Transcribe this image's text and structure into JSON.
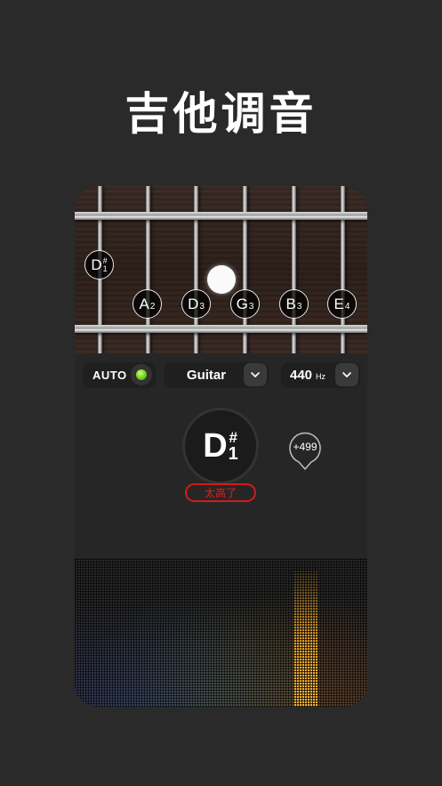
{
  "headline": "吉他调音",
  "strings": [
    {
      "letter": "A",
      "octave": "2"
    },
    {
      "letter": "D",
      "octave": "3"
    },
    {
      "letter": "G",
      "octave": "3"
    },
    {
      "letter": "B",
      "octave": "3"
    },
    {
      "letter": "E",
      "octave": "4"
    }
  ],
  "detected_marker": {
    "letter": "D",
    "sharp": "#",
    "octave": "1"
  },
  "controls": {
    "auto_label": "AUTO",
    "auto_enabled": true,
    "led_color": "#6fd21c",
    "instrument": "Guitar",
    "reference_freq": "440",
    "reference_unit": "Hz"
  },
  "tuner": {
    "note_letter": "D",
    "note_sharp": "#",
    "note_octave": "1",
    "status": "太高了",
    "status_color": "#e02020",
    "cents": "+499"
  },
  "spectrum": {
    "level_fraction": 0.92,
    "bar_color": "#e4a22a"
  }
}
